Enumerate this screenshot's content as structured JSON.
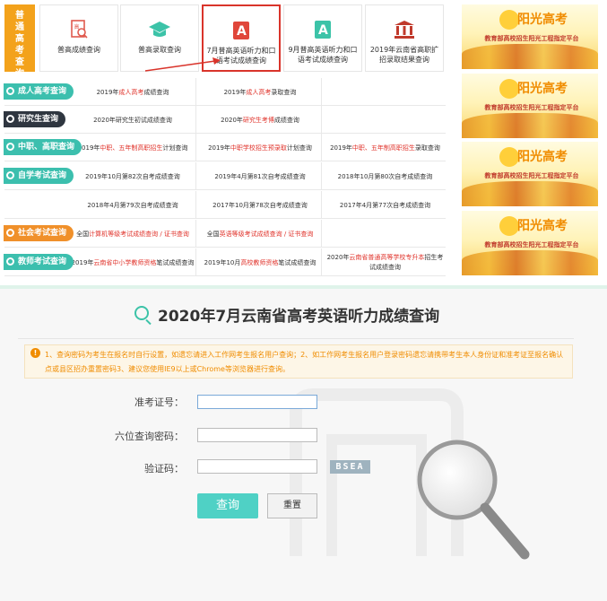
{
  "category_main": "普通高考查询",
  "top_tabs": [
    {
      "label": "普高成绩查询",
      "icon": "grade-report-icon"
    },
    {
      "label": "普高录取查询",
      "icon": "graduation-cap-icon"
    },
    {
      "label": "7月普高英语听力和口语考试成绩查询",
      "icon": "english-a-icon"
    },
    {
      "label": "9月普高英语听力和口语考试成绩查询",
      "icon": "english-a-icon"
    },
    {
      "label": "2019年云南省高职扩招录取结果查询",
      "icon": "institution-icon"
    }
  ],
  "categories": [
    {
      "label": "成人高考查询",
      "color": "#3cbfae"
    },
    {
      "label": "研究生查询",
      "color": "#2f3640"
    },
    {
      "label": "中职、高职查询",
      "color": "#3cbfae"
    },
    {
      "label": "自学考试查询",
      "color": "#3cbfae"
    },
    {
      "label": "社会考试查询",
      "color": "#f0902a"
    },
    {
      "label": "教师考试查询",
      "color": "#3cbfae"
    }
  ],
  "rows": [
    {
      "cells": [
        {
          "pre": "2019年",
          "hl": "成人高考",
          "post": "成绩查询"
        },
        {
          "pre": "2019年",
          "hl": "成人高考",
          "post": "录取查询"
        },
        {
          "pre": "",
          "hl": "",
          "post": ""
        }
      ]
    },
    {
      "cells": [
        {
          "pre": "2020年研究生初试成绩查询",
          "hl": "",
          "post": ""
        },
        {
          "pre": "2020年",
          "hl": "研究生考博",
          "post": "成绩查询"
        },
        {
          "pre": "",
          "hl": "",
          "post": ""
        }
      ]
    },
    {
      "cells": [
        {
          "pre": "2019年",
          "hl": "中职、五年制高职招生",
          "post": "计划查询"
        },
        {
          "pre": "2019年",
          "hl": "中职学校招生预录取",
          "post": "计划查询"
        },
        {
          "pre": "2019年",
          "hl": "中职、五年制高职招生",
          "post": "录取查询"
        }
      ]
    },
    {
      "cells": [
        {
          "pre": "2019年10月第82次自考成绩查询",
          "hl": "",
          "post": ""
        },
        {
          "pre": "2019年4月第81次自考成绩查询",
          "hl": "",
          "post": ""
        },
        {
          "pre": "2018年10月第80次自考成绩查询",
          "hl": "",
          "post": ""
        }
      ]
    },
    {
      "cells": [
        {
          "pre": "2018年4月第79次自考成绩查询",
          "hl": "",
          "post": ""
        },
        {
          "pre": "2017年10月第78次自考成绩查询",
          "hl": "",
          "post": ""
        },
        {
          "pre": "2017年4月第77次自考成绩查询",
          "hl": "",
          "post": ""
        }
      ]
    },
    {
      "cells": [
        {
          "pre": "全国",
          "hl": "计算机等级考试成绩查询 / 证书查询",
          "post": ""
        },
        {
          "pre": "全国",
          "hl": "英语等级考试成绩查询 / 证书查询",
          "post": ""
        },
        {
          "pre": "",
          "hl": "",
          "post": ""
        }
      ]
    },
    {
      "cells": [
        {
          "pre": "2019年",
          "hl": "云南省中小学教师资格",
          "post": "笔试成绩查询"
        },
        {
          "pre": "2019年10月",
          "hl": "高校教师资格",
          "post": "笔试成绩查询"
        },
        {
          "pre": "2020年",
          "hl": "云南省普通高等学校专升本",
          "post": "招生考试成绩查询"
        }
      ]
    }
  ],
  "banner": {
    "title": "阳光高考",
    "subtitle": "教育部高校招生阳光工程指定平台"
  },
  "query": {
    "title": "2020年7月云南省高考英语听力成绩查询",
    "notice": "1、查询密码为考生在报名时自行设置，如遗忘请进入工作网考生报名用户查询；2、如工作网考生报名用户登录密码遗忘请携带考生本人身份证和准考证至报名确认点或县区招办重置密码3、建议您使用IE9以上或Chrome等浏览器进行查询。",
    "fields": [
      {
        "label": "准考证号：",
        "value": ""
      },
      {
        "label": "六位查询密码：",
        "value": ""
      },
      {
        "label": "验证码：",
        "value": ""
      }
    ],
    "captcha": "BSEA",
    "submit_label": "查询",
    "reset_label": "重置"
  },
  "colors": {
    "accent": "#3cbfae",
    "highlight": "#e0332b",
    "orange": "#f3a21b"
  }
}
